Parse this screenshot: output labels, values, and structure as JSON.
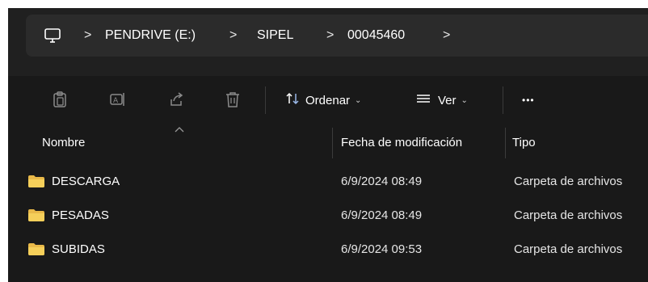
{
  "breadcrumb": {
    "separator": ">",
    "items": [
      "PENDRIVE (E:)",
      "SIPEL",
      "00045460"
    ]
  },
  "toolbar": {
    "icons": [
      "cut-icon",
      "paste-icon",
      "rename-icon",
      "share-icon",
      "delete-icon"
    ],
    "sort_label": "Ordenar",
    "view_label": "Ver",
    "more_label": "•••"
  },
  "columns": {
    "name": "Nombre",
    "modified": "Fecha de modificación",
    "type": "Tipo"
  },
  "files": [
    {
      "name": "DESCARGA",
      "modified": "6/9/2024 08:49",
      "type": "Carpeta de archivos"
    },
    {
      "name": "PESADAS",
      "modified": "6/9/2024 08:49",
      "type": "Carpeta de archivos"
    },
    {
      "name": "SUBIDAS",
      "modified": "6/9/2024 09:53",
      "type": "Carpeta de archivos"
    }
  ],
  "colors": {
    "background": "#191919",
    "address_bar": "#2b2b2b",
    "folder": "#f2c94c",
    "accent_icon": "#9ab8e8"
  }
}
